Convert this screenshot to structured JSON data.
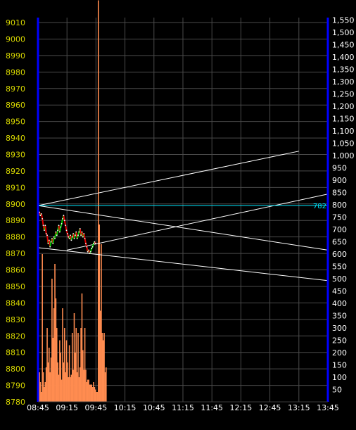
{
  "chart_data": {
    "type": "line",
    "title": "",
    "xlabel": "",
    "ylabel": "",
    "colors": {
      "background": "#000000",
      "grid": "#4a4a4a",
      "price_axis_text": "#d8d800",
      "volume_axis_text": "#ffffff",
      "axis_line": "#0000ff",
      "up_tick": "#00c000",
      "down_tick": "#e00000",
      "volume": "#ff8c50",
      "trendline": "#ffffff",
      "horizontal_line": "#00e8ff",
      "time_label": "#ffffff"
    },
    "price_axis": {
      "side": "left",
      "ylim": [
        8780,
        9013
      ],
      "ticks": [
        9010,
        9000,
        8990,
        8980,
        8970,
        8960,
        8950,
        8940,
        8930,
        8920,
        8910,
        8900,
        8890,
        8880,
        8870,
        8860,
        8850,
        8840,
        8830,
        8820,
        8810,
        8800,
        8790,
        8780
      ]
    },
    "volume_axis": {
      "side": "right",
      "ylim": [
        0,
        1560
      ],
      "ticks": [
        "1,550",
        "1,500",
        "1,450",
        "1,400",
        "1,350",
        "1,300",
        "1,250",
        "1,200",
        "1,150",
        "1,100",
        "1,050",
        "1,000",
        "950",
        "900",
        "850",
        "800",
        "750",
        "700",
        "650",
        "600",
        "550",
        "500",
        "450",
        "400",
        "350",
        "300",
        "250",
        "200",
        "150",
        "100",
        "50"
      ]
    },
    "time_axis": {
      "labels": [
        "08:45",
        "09:15",
        "09:45",
        "10:15",
        "10:45",
        "11:15",
        "11:45",
        "12:15",
        "12:45",
        "13:15",
        "13:45"
      ],
      "xlim_minutes": [
        0,
        300
      ]
    },
    "grid": true,
    "horizontal_line": {
      "value": 8899,
      "label": "782"
    },
    "trendlines": [
      {
        "from": [
          "08:45",
          8899
        ],
        "to": [
          "13:45",
          8872
        ]
      },
      {
        "from": [
          "08:45",
          8899
        ],
        "to": [
          "13:15",
          8932
        ]
      },
      {
        "from": [
          "09:15",
          8872
        ],
        "to": [
          "13:45",
          8906
        ]
      },
      {
        "from": [
          "08:45",
          8873.5
        ],
        "to": [
          "13:45",
          8853.5
        ]
      }
    ],
    "price": [
      8893,
      8895,
      8893,
      8894,
      8891,
      8887,
      8884,
      8887,
      8882,
      8881,
      8876,
      8878,
      8874,
      8877,
      8879,
      8876,
      8880,
      8879,
      8883,
      8881,
      8884,
      8887,
      8883,
      8886,
      8888,
      8891,
      8893,
      8890,
      8887,
      8884,
      8882,
      8880,
      8879,
      8881,
      8878,
      8880,
      8882,
      8879,
      8881,
      8883,
      8879,
      8881,
      8883,
      8885,
      8881,
      8883,
      8880,
      8882,
      8879,
      8876,
      8874,
      8871,
      8872,
      8870,
      8871,
      8873,
      8874,
      8876,
      8877,
      8876
    ],
    "volume": [
      170,
      120,
      80,
      40,
      600,
      120,
      60,
      80,
      140,
      300,
      160,
      220,
      120,
      180,
      500,
      260,
      380,
      560,
      420,
      300,
      160,
      110,
      250,
      200,
      90,
      380,
      160,
      300,
      120,
      250,
      160,
      100,
      230,
      100,
      110,
      280,
      130,
      360,
      200,
      300,
      120,
      280,
      100,
      140,
      300,
      440,
      210,
      130,
      300,
      130,
      80,
      90,
      90,
      70,
      70,
      70,
      60,
      80,
      60,
      50,
      40,
      40,
      1630,
      720,
      370,
      640,
      280,
      250,
      280,
      120,
      140
    ]
  }
}
